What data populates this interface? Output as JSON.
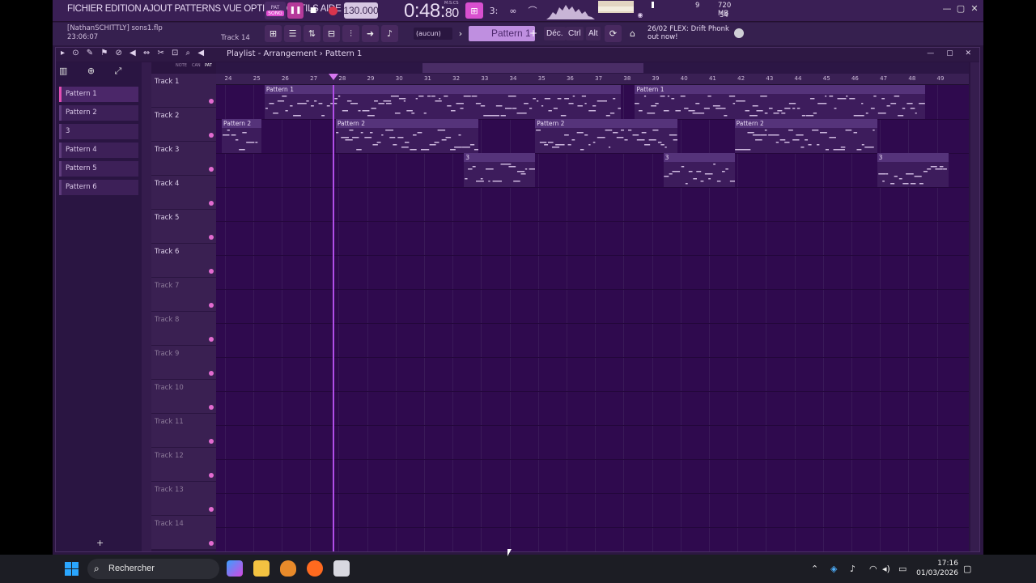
{
  "menu": {
    "text": "FICHIER EDITION AJOUT PATTERNS VUE OPTIONS OUTILS AIDE"
  },
  "transport": {
    "pat_label": "PAT",
    "song_label": "SONG",
    "tempo": "130.000",
    "time": "0:48",
    "time_ms": "80",
    "time_unit": "M:S:CS"
  },
  "system": {
    "mem_a": "9",
    "mem_b": "720 MB",
    "mem_c": "34"
  },
  "hint": {
    "user": "[NathanSCHITTLY] sons1.flp",
    "time": "23:06:07",
    "track": "Track 14"
  },
  "toolbar2": {
    "preset": "(aucun)",
    "pattern": "Pattern 1",
    "dec": "Déc.",
    "ctrl": "Ctrl",
    "alt": "Alt",
    "news_date": "26/02",
    "news_title": "FLEX: Drift Phonk",
    "news_sub": "out now!"
  },
  "playlist": {
    "title": "Playlist - Arrangement",
    "crumb_sep": "›",
    "pattern": "Pattern 1"
  },
  "picker": {
    "items": [
      "Pattern 1",
      "Pattern 2",
      "3",
      "Pattern 4",
      "Pattern 5",
      "Pattern 6"
    ],
    "add": "+"
  },
  "head_tools": {
    "note": "NOTE",
    "can": "CAN",
    "pat": "PAT"
  },
  "tracks": [
    "Track 1",
    "Track 2",
    "Track 3",
    "Track 4",
    "Track 5",
    "Track 6",
    "Track 7",
    "Track 8",
    "Track 9",
    "Track 10",
    "Track 11",
    "Track 12",
    "Track 13",
    "Track 14"
  ],
  "ruler": [
    "24",
    "25",
    "26",
    "27",
    "28",
    "29",
    "30",
    "31",
    "32",
    "33",
    "34",
    "35",
    "36",
    "37",
    "38",
    "39",
    "40",
    "41",
    "42",
    "43",
    "44",
    "45",
    "46",
    "47",
    "48",
    "49"
  ],
  "clips": [
    {
      "label": "Pattern 1",
      "track": 1,
      "start": 25.4,
      "end": 37.9
    },
    {
      "label": "Pattern 1",
      "track": 1,
      "start": 38.4,
      "end": 48.6
    },
    {
      "label": "Pattern 2",
      "track": 2,
      "start": 23.9,
      "end": 25.3
    },
    {
      "label": "Pattern 2",
      "track": 2,
      "start": 27.9,
      "end": 32.9
    },
    {
      "label": "Pattern 2",
      "track": 2,
      "start": 34.9,
      "end": 39.9
    },
    {
      "label": "Pattern 2",
      "track": 2,
      "start": 41.9,
      "end": 46.9
    },
    {
      "label": "3",
      "track": 3,
      "start": 32.4,
      "end": 34.9
    },
    {
      "label": "3",
      "track": 3,
      "start": 39.4,
      "end": 41.9
    },
    {
      "label": "3",
      "track": 3,
      "start": 46.9,
      "end": 49.4
    }
  ],
  "taskbar": {
    "search": "Rechercher",
    "time": "17:16",
    "date": "01/03/2026"
  },
  "colors": {
    "accent": "#d84fcf",
    "clip_bg": "#3d1c5c",
    "grid_bg": "#2f0a4e"
  }
}
